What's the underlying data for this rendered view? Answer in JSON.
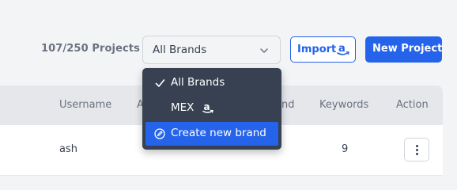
{
  "toolbar": {
    "project_count": "107/250 Projects",
    "brand_select_value": "All Brands",
    "import_label": "Import",
    "new_project_label": "New Project"
  },
  "table": {
    "headers": [
      "Username",
      "A",
      "nd",
      "Keywords",
      "Action"
    ],
    "rows": [
      {
        "username": "ash",
        "keywords": "9"
      }
    ]
  },
  "brand_dropdown": {
    "items": [
      {
        "label": "All Brands",
        "selected": true
      },
      {
        "label": "MEX",
        "marketplace_icon": "amazon-icon"
      },
      {
        "label": "Create new brand",
        "highlighted": true
      }
    ]
  },
  "colors": {
    "accent": "#2563eb",
    "dropdown_bg": "#374151",
    "header_bg": "#e5e7eb",
    "page_bg": "#f3f4f6"
  }
}
